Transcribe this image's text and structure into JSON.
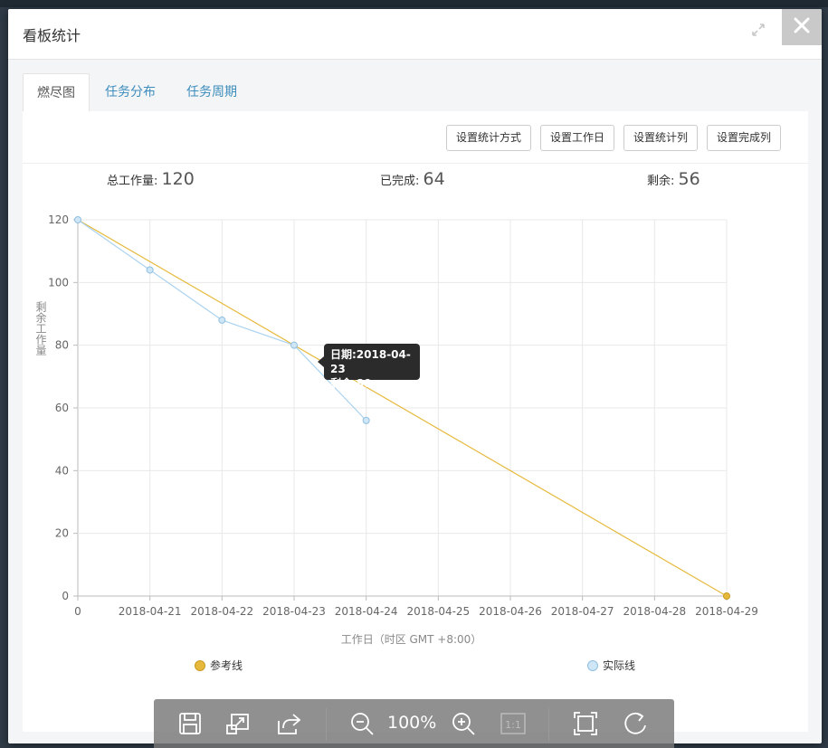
{
  "dialog": {
    "title": "看板统计"
  },
  "tabs": [
    {
      "label": "燃尽图",
      "active": true
    },
    {
      "label": "任务分布",
      "active": false
    },
    {
      "label": "任务周期",
      "active": false
    }
  ],
  "toolbar": {
    "buttons": [
      "设置统计方式",
      "设置工作日",
      "设置统计列",
      "设置完成列"
    ]
  },
  "stats": {
    "total_label": "总工作量:",
    "total_value": "120",
    "done_label": "已完成:",
    "done_value": "64",
    "remaining_label": "剩余:",
    "remaining_value": "56"
  },
  "tooltip": {
    "line1": "日期:2018-04-23",
    "line2": "剩余:80"
  },
  "chart_data": {
    "type": "line",
    "x": [
      "2018-04-20",
      "2018-04-21",
      "2018-04-22",
      "2018-04-23",
      "2018-04-24",
      "2018-04-25",
      "2018-04-26",
      "2018-04-27",
      "2018-04-28",
      "2018-04-29"
    ],
    "x_tick_labels": [
      "0",
      "2018-04-21",
      "2018-04-22",
      "2018-04-23",
      "2018-04-24",
      "2018-04-25",
      "2018-04-26",
      "2018-04-27",
      "2018-04-28",
      "2018-04-29"
    ],
    "series": [
      {
        "name": "参考线",
        "color": "#e6b93c",
        "points": [
          [
            "2018-04-20",
            120
          ],
          [
            "2018-04-29",
            0
          ]
        ]
      },
      {
        "name": "实际线",
        "color": "#a9d2f0",
        "points": [
          [
            "2018-04-20",
            120
          ],
          [
            "2018-04-21",
            104
          ],
          [
            "2018-04-22",
            88
          ],
          [
            "2018-04-23",
            80
          ],
          [
            "2018-04-24",
            56
          ]
        ]
      }
    ],
    "xlabel": "工作日（时区 GMT +8:00）",
    "ylabel": "剩余工作量",
    "ylim": [
      0,
      120
    ],
    "yticks": [
      0,
      20,
      40,
      60,
      80,
      100,
      120
    ],
    "grid": true,
    "legend": "bottom"
  },
  "viewer": {
    "zoom_label": "100%",
    "icons": [
      "save-icon",
      "export-icon",
      "share-icon",
      "zoom-out-icon",
      "zoom-in-icon",
      "actual-size-icon",
      "fit-icon",
      "rotate-icon"
    ],
    "actual_size_label": "1:1"
  }
}
